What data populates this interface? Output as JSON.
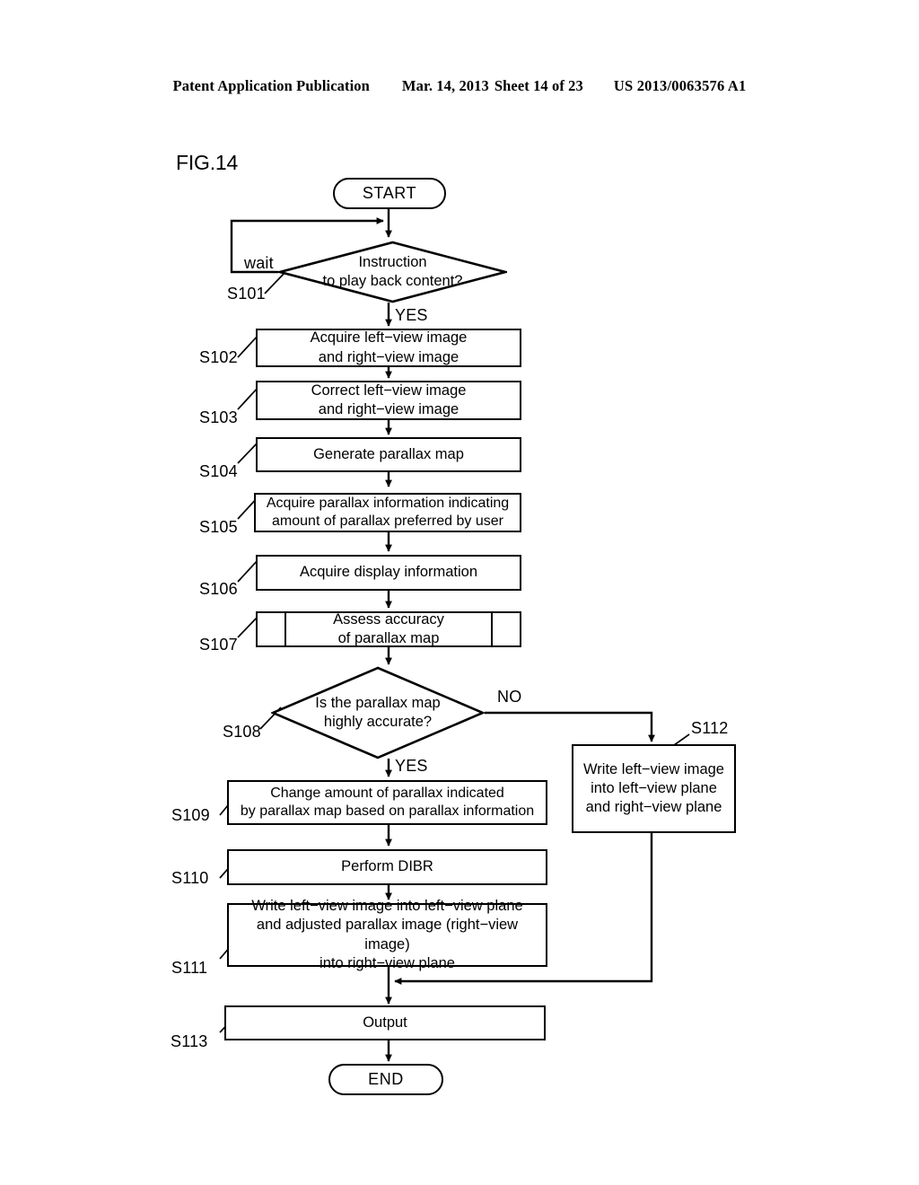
{
  "header": {
    "publication": "Patent Application Publication",
    "date": "Mar. 14, 2013",
    "sheet": "Sheet 14 of 23",
    "number": "US 2013/0063576 A1"
  },
  "figure": {
    "label": "FIG.14"
  },
  "flowchart": {
    "start": {
      "label": "START"
    },
    "end": {
      "label": "END"
    },
    "branch_labels": {
      "wait": "wait",
      "yes_s101": "YES",
      "no_s108": "NO",
      "yes_s108": "YES"
    },
    "steps": [
      {
        "id": "S101",
        "tag": "S101",
        "shape": "decision",
        "lines": [
          "Instruction",
          "to play back content?"
        ]
      },
      {
        "id": "S102",
        "tag": "S102",
        "shape": "process",
        "lines": [
          "Acquire left−view image",
          "and right−view image"
        ]
      },
      {
        "id": "S103",
        "tag": "S103",
        "shape": "process",
        "lines": [
          "Correct left−view image",
          "and right−view image"
        ]
      },
      {
        "id": "S104",
        "tag": "S104",
        "shape": "process",
        "lines": [
          "Generate parallax map"
        ]
      },
      {
        "id": "S105",
        "tag": "S105",
        "shape": "process",
        "lines": [
          "Acquire parallax information indicating",
          "amount of parallax preferred by user"
        ]
      },
      {
        "id": "S106",
        "tag": "S106",
        "shape": "process",
        "lines": [
          "Acquire display information"
        ]
      },
      {
        "id": "S107",
        "tag": "S107",
        "shape": "predefined-process",
        "lines": [
          "Assess accuracy",
          "of parallax map"
        ]
      },
      {
        "id": "S108",
        "tag": "S108",
        "shape": "decision",
        "lines": [
          "Is the parallax map",
          "highly accurate?"
        ]
      },
      {
        "id": "S109",
        "tag": "S109",
        "shape": "process",
        "lines": [
          "Change amount of parallax indicated",
          "by parallax map based on parallax information"
        ]
      },
      {
        "id": "S110",
        "tag": "S110",
        "shape": "process",
        "lines": [
          "Perform DIBR"
        ]
      },
      {
        "id": "S111",
        "tag": "S111",
        "shape": "process",
        "lines": [
          "Write left−view image into left−view plane",
          "and adjusted parallax image (right−view image)",
          "into right−view plane"
        ]
      },
      {
        "id": "S112",
        "tag": "S112",
        "shape": "process",
        "lines": [
          "Write left−view image",
          "into left−view plane",
          "and right−view plane"
        ]
      },
      {
        "id": "S113",
        "tag": "S113",
        "shape": "process",
        "lines": [
          "Output"
        ]
      }
    ]
  },
  "colors": {
    "ink": "#000000",
    "paper": "#ffffff"
  }
}
